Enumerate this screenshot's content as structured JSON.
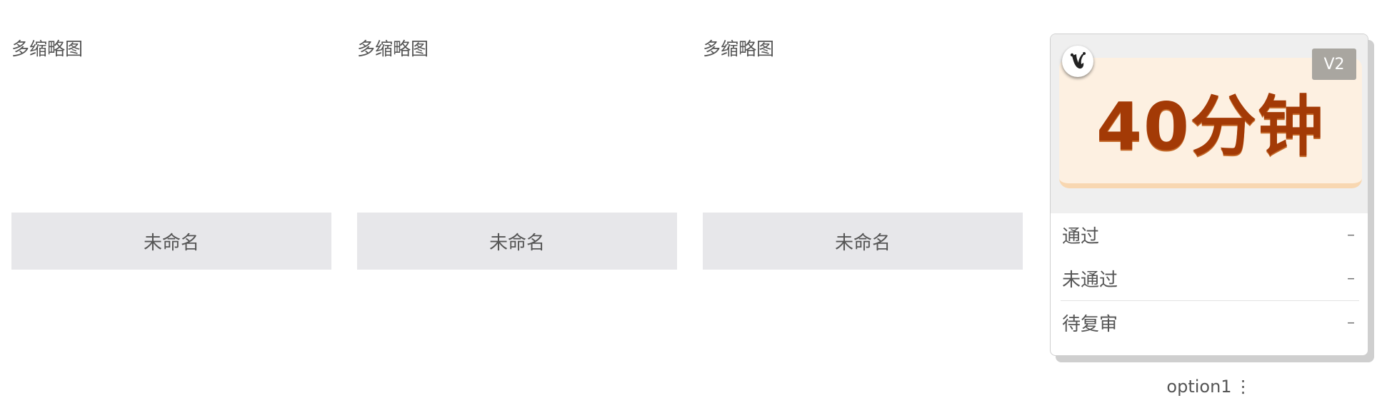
{
  "thumbnails": [
    {
      "title": "多缩略图",
      "name": "未命名"
    },
    {
      "title": "多缩略图",
      "name": "未命名"
    },
    {
      "title": "多缩略图",
      "name": "未命名"
    }
  ],
  "card": {
    "banner_text": "40分钟",
    "version": "V2",
    "statuses": [
      {
        "label": "通过",
        "value": "–"
      },
      {
        "label": "未通过",
        "value": "–"
      },
      {
        "label": "待复审",
        "value": "–"
      }
    ],
    "option_label": "option1",
    "menu_icon": "⋮",
    "colors": {
      "banner_bg": "#fdf0e1",
      "banner_text": "#a33a06",
      "badge_bg": "#a9a6a0"
    }
  }
}
